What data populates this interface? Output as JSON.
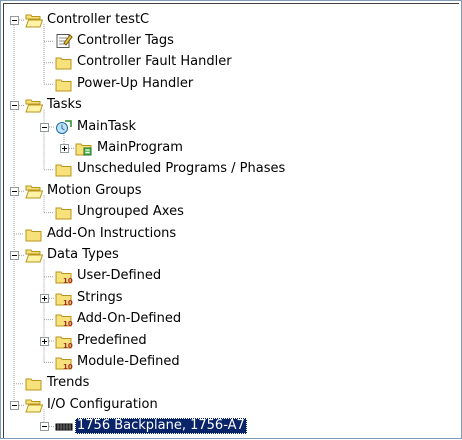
{
  "tree": {
    "nodes": [
      {
        "id": "controller",
        "label": "Controller testC",
        "icon": "folder-open-icon",
        "expander": "minus"
      },
      {
        "id": "controller-tags",
        "label": "Controller Tags",
        "icon": "tags-document-icon"
      },
      {
        "id": "controller-fault-handler",
        "label": "Controller Fault Handler",
        "icon": "folder-icon"
      },
      {
        "id": "power-up-handler",
        "label": "Power-Up Handler",
        "icon": "folder-icon"
      },
      {
        "id": "tasks",
        "label": "Tasks",
        "icon": "folder-open-icon",
        "expander": "minus"
      },
      {
        "id": "maintask",
        "label": "MainTask",
        "icon": "task-icon",
        "expander": "minus"
      },
      {
        "id": "mainprogram",
        "label": "MainProgram",
        "icon": "program-icon",
        "expander": "plus"
      },
      {
        "id": "unscheduled-programs",
        "label": "Unscheduled Programs / Phases",
        "icon": "folder-icon"
      },
      {
        "id": "motion-groups",
        "label": "Motion Groups",
        "icon": "folder-open-icon",
        "expander": "minus"
      },
      {
        "id": "ungrouped-axes",
        "label": "Ungrouped Axes",
        "icon": "folder-icon"
      },
      {
        "id": "add-on-instructions",
        "label": "Add-On Instructions",
        "icon": "folder-icon"
      },
      {
        "id": "data-types",
        "label": "Data Types",
        "icon": "folder-open-icon",
        "expander": "minus"
      },
      {
        "id": "user-defined",
        "label": "User-Defined",
        "icon": "datatype-folder-icon"
      },
      {
        "id": "strings",
        "label": "Strings",
        "icon": "datatype-folder-icon",
        "expander": "plus"
      },
      {
        "id": "add-on-defined",
        "label": "Add-On-Defined",
        "icon": "datatype-folder-icon"
      },
      {
        "id": "predefined",
        "label": "Predefined",
        "icon": "datatype-folder-icon",
        "expander": "plus"
      },
      {
        "id": "module-defined",
        "label": "Module-Defined",
        "icon": "datatype-folder-icon"
      },
      {
        "id": "trends",
        "label": "Trends",
        "icon": "folder-icon"
      },
      {
        "id": "io-configuration",
        "label": "I/O Configuration",
        "icon": "folder-open-icon",
        "expander": "minus"
      },
      {
        "id": "backplane",
        "label": "1756 Backplane, 1756-A7",
        "icon": "backplane-icon",
        "expander": "minus",
        "selected": true
      }
    ]
  },
  "colors": {
    "folder": "#f7e17a",
    "folder_edge": "#b8951d",
    "selection": "#0a246a",
    "tree_lines": "#a0a0a0"
  }
}
